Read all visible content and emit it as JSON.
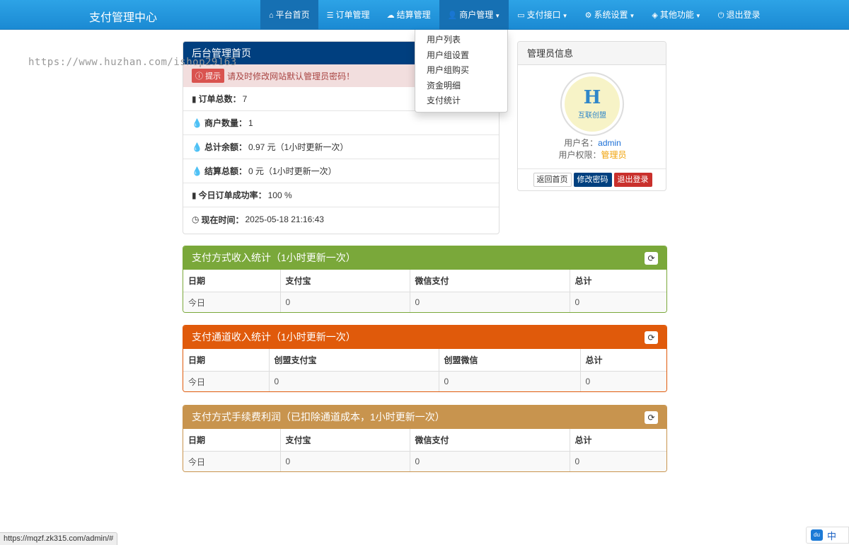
{
  "brand": "支付管理中心",
  "nav": [
    {
      "label": "平台首页",
      "icon": "home-icon",
      "glyph": "⌂"
    },
    {
      "label": "订单管理",
      "icon": "list-icon",
      "glyph": "☰"
    },
    {
      "label": "结算管理",
      "icon": "cloud-icon",
      "glyph": "☁"
    },
    {
      "label": "商户管理",
      "icon": "user-icon",
      "glyph": "👤"
    },
    {
      "label": "支付接口",
      "icon": "credit-card-icon",
      "glyph": "▭"
    },
    {
      "label": "系统设置",
      "icon": "gear-icon",
      "glyph": "⚙"
    },
    {
      "label": "其他功能",
      "icon": "cube-icon",
      "glyph": "◈"
    },
    {
      "label": "退出登录",
      "icon": "power-icon",
      "glyph": "⏻"
    }
  ],
  "dropdown": [
    "用户列表",
    "用户组设置",
    "用户组购买",
    "资金明细",
    "支付统计"
  ],
  "watermark": "https://www.huzhan.com/ishop29163",
  "home": {
    "title": "后台管理首页",
    "alert_tag": "提示",
    "alert_text": "请及时修改网站默认管理员密码！",
    "rows": [
      {
        "icon": "bar-chart-icon",
        "glyph": "▮",
        "label": "订单总数：",
        "value": "7"
      },
      {
        "icon": "drop-icon",
        "glyph": "💧",
        "label": "商户数量：",
        "value": "1"
      },
      {
        "icon": "drop-icon",
        "glyph": "💧",
        "label": "总计余额：",
        "value": "0.97 元（1小时更新一次）"
      },
      {
        "icon": "drop-icon",
        "glyph": "💧",
        "label": "结算总额：",
        "value": "0 元（1小时更新一次）"
      },
      {
        "icon": "bar-chart-icon",
        "glyph": "▮",
        "label": "今日订单成功率：",
        "value": "100 %"
      },
      {
        "icon": "clock-icon",
        "glyph": "◷",
        "label": "现在时间：",
        "value": " 2025-05-18 21:16:43"
      }
    ]
  },
  "admin": {
    "title": "管理员信息",
    "logo_letters": "H",
    "logo_text": "互联创盟",
    "username_label": "用户名：",
    "username": "admin",
    "role_label": "用户权限：",
    "role": "管理员",
    "btn_home": "返回首页",
    "btn_pwd": "修改密码",
    "btn_logout": "退出登录"
  },
  "stats": [
    {
      "title": "支付方式收入统计（1小时更新一次）",
      "color": "#7aa83a",
      "headers": [
        "日期",
        "支付宝",
        "微信支付",
        "总计"
      ],
      "row": [
        "今日",
        "0",
        "0",
        "0"
      ]
    },
    {
      "title": "支付通道收入统计（1小时更新一次）",
      "color": "#e05a0b",
      "headers": [
        "日期",
        "创盟支付宝",
        "创盟微信",
        "总计"
      ],
      "row": [
        "今日",
        "0",
        "0",
        "0"
      ]
    },
    {
      "title": "支付方式手续费利润（已扣除通道成本，1小时更新一次）",
      "color": "#c8944e",
      "headers": [
        "日期",
        "支付宝",
        "微信支付",
        "总计"
      ],
      "row": [
        "今日",
        "0",
        "0",
        "0"
      ]
    }
  ],
  "status_url": "https://mqzf.zk315.com/admin/#",
  "ime": {
    "badge": "du",
    "label": "中"
  }
}
